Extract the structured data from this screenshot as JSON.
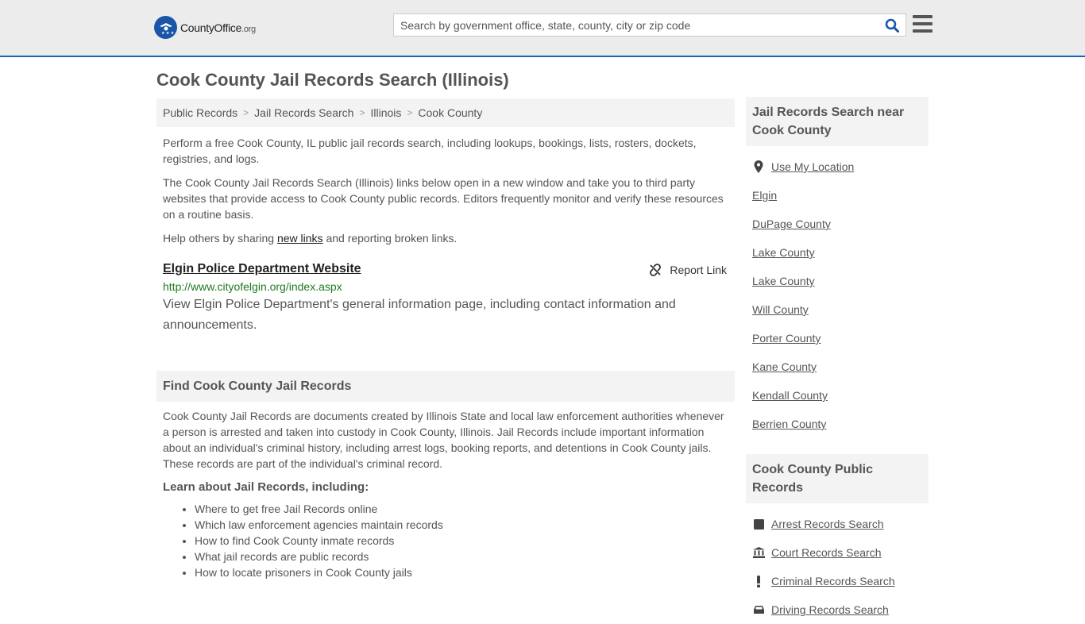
{
  "header": {
    "logo_text_main": "CountyOffice",
    "logo_text_suffix": ".org",
    "search_placeholder": "Search by government office, state, county, city or zip code",
    "search_value": ""
  },
  "page": {
    "title": "Cook County Jail Records Search (Illinois)"
  },
  "breadcrumb": [
    {
      "label": "Public Records"
    },
    {
      "label": "Jail Records Search"
    },
    {
      "label": "Illinois"
    },
    {
      "label": "Cook County"
    }
  ],
  "intro": {
    "p1": "Perform a free Cook County, IL public jail records search, including lookups, bookings, lists, rosters, dockets, registries, and logs.",
    "p2": "The Cook County Jail Records Search (Illinois) links below open in a new window and take you to third party websites that provide access to Cook County public records. Editors frequently monitor and verify these resources on a routine basis.",
    "p3_before": "Help others by sharing ",
    "p3_link": "new links",
    "p3_after": " and reporting broken links."
  },
  "listing": {
    "title": "Elgin Police Department Website",
    "report_label": "Report Link",
    "url": "http://www.cityofelgin.org/index.aspx",
    "description": "View Elgin Police Department's general information page, including contact information and announcements."
  },
  "find_section": {
    "heading": "Find Cook County Jail Records",
    "body": "Cook County Jail Records are documents created by Illinois State and local law enforcement authorities whenever a person is arrested and taken into custody in Cook County, Illinois. Jail Records include important information about an individual's criminal history, including arrest logs, booking reports, and detentions in Cook County jails. These records are part of the individual's criminal record.",
    "learn_heading": "Learn about Jail Records, including:",
    "learn_items": [
      "Where to get free Jail Records online",
      "Which law enforcement agencies maintain records",
      "How to find Cook County inmate records",
      "What jail records are public records",
      "How to locate prisoners in Cook County jails"
    ]
  },
  "sidebar": {
    "nearby_heading": "Jail Records Search near Cook County",
    "use_location": "Use My Location",
    "nearby": [
      "Elgin",
      "DuPage County",
      "Lake County",
      "Lake County",
      "Will County",
      "Porter County",
      "Kane County",
      "Kendall County",
      "Berrien County"
    ],
    "public_heading": "Cook County Public Records",
    "public_records": [
      {
        "label": "Arrest Records Search",
        "icon": "square-icon"
      },
      {
        "label": "Court Records Search",
        "icon": "courthouse-icon"
      },
      {
        "label": "Criminal Records Search",
        "icon": "exclamation-icon"
      },
      {
        "label": "Driving Records Search",
        "icon": "car-icon"
      }
    ]
  },
  "colors": {
    "header_bg": "#ececec",
    "header_border": "#1565c0",
    "brand_blue": "#1a56a8",
    "url_green": "#1e7a1e",
    "panel_bg": "#f3f3f3"
  }
}
